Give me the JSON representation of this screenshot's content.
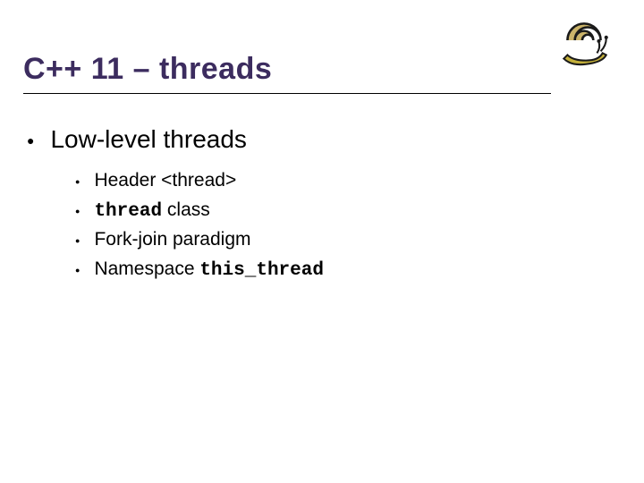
{
  "slide": {
    "title": "C++ 11 – threads",
    "icon": "snail-icon"
  },
  "content": {
    "heading": "Low-level threads",
    "items": [
      {
        "plain_before": "Header <thread>",
        "mono": "",
        "plain_after": ""
      },
      {
        "plain_before": "",
        "mono": "thread",
        "plain_after": " class"
      },
      {
        "plain_before": "Fork-join paradigm",
        "mono": "",
        "plain_after": ""
      },
      {
        "plain_before": "Namespace ",
        "mono": "this_thread",
        "plain_after": ""
      }
    ]
  }
}
